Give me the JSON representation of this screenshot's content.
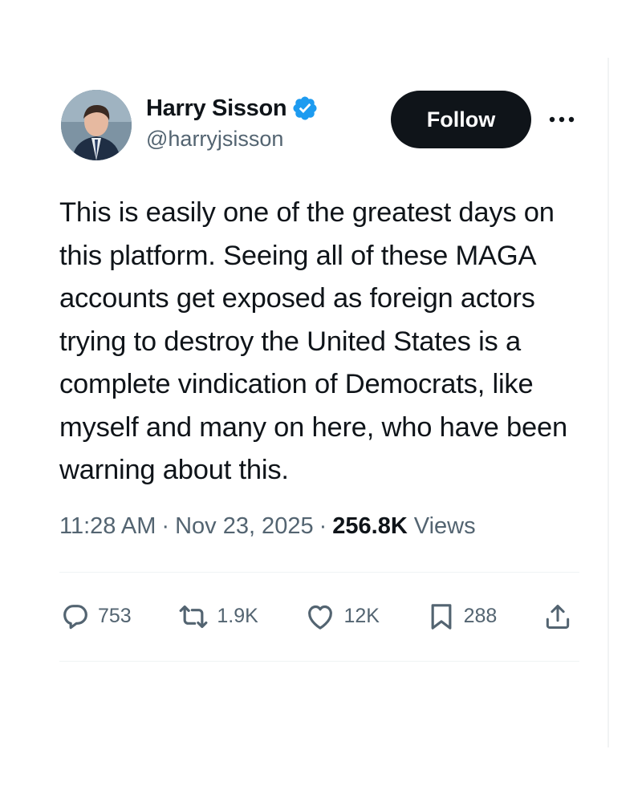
{
  "author": {
    "display_name": "Harry Sisson",
    "handle": "@harryjsisson",
    "verified": true
  },
  "follow_button_label": "Follow",
  "more_icon": "more-horizontal-icon",
  "tweet": {
    "text": "This is easily one of the greatest days on this platform. Seeing all of these MAGA accounts get exposed as foreign actors trying to destroy the United States is a complete vindication of Democrats, like myself and many on here, who have been warning about this.",
    "time": "11:28 AM",
    "date": "Nov 23, 2025",
    "views_count": "256.8K",
    "views_label": "Views"
  },
  "actions": {
    "replies": "753",
    "reposts": "1.9K",
    "likes": "12K",
    "bookmarks": "288"
  },
  "colors": {
    "primary_text": "#0f1419",
    "secondary_text": "#536471",
    "verified_blue": "#1d9bf0",
    "follow_button_bg": "#0f1419"
  }
}
